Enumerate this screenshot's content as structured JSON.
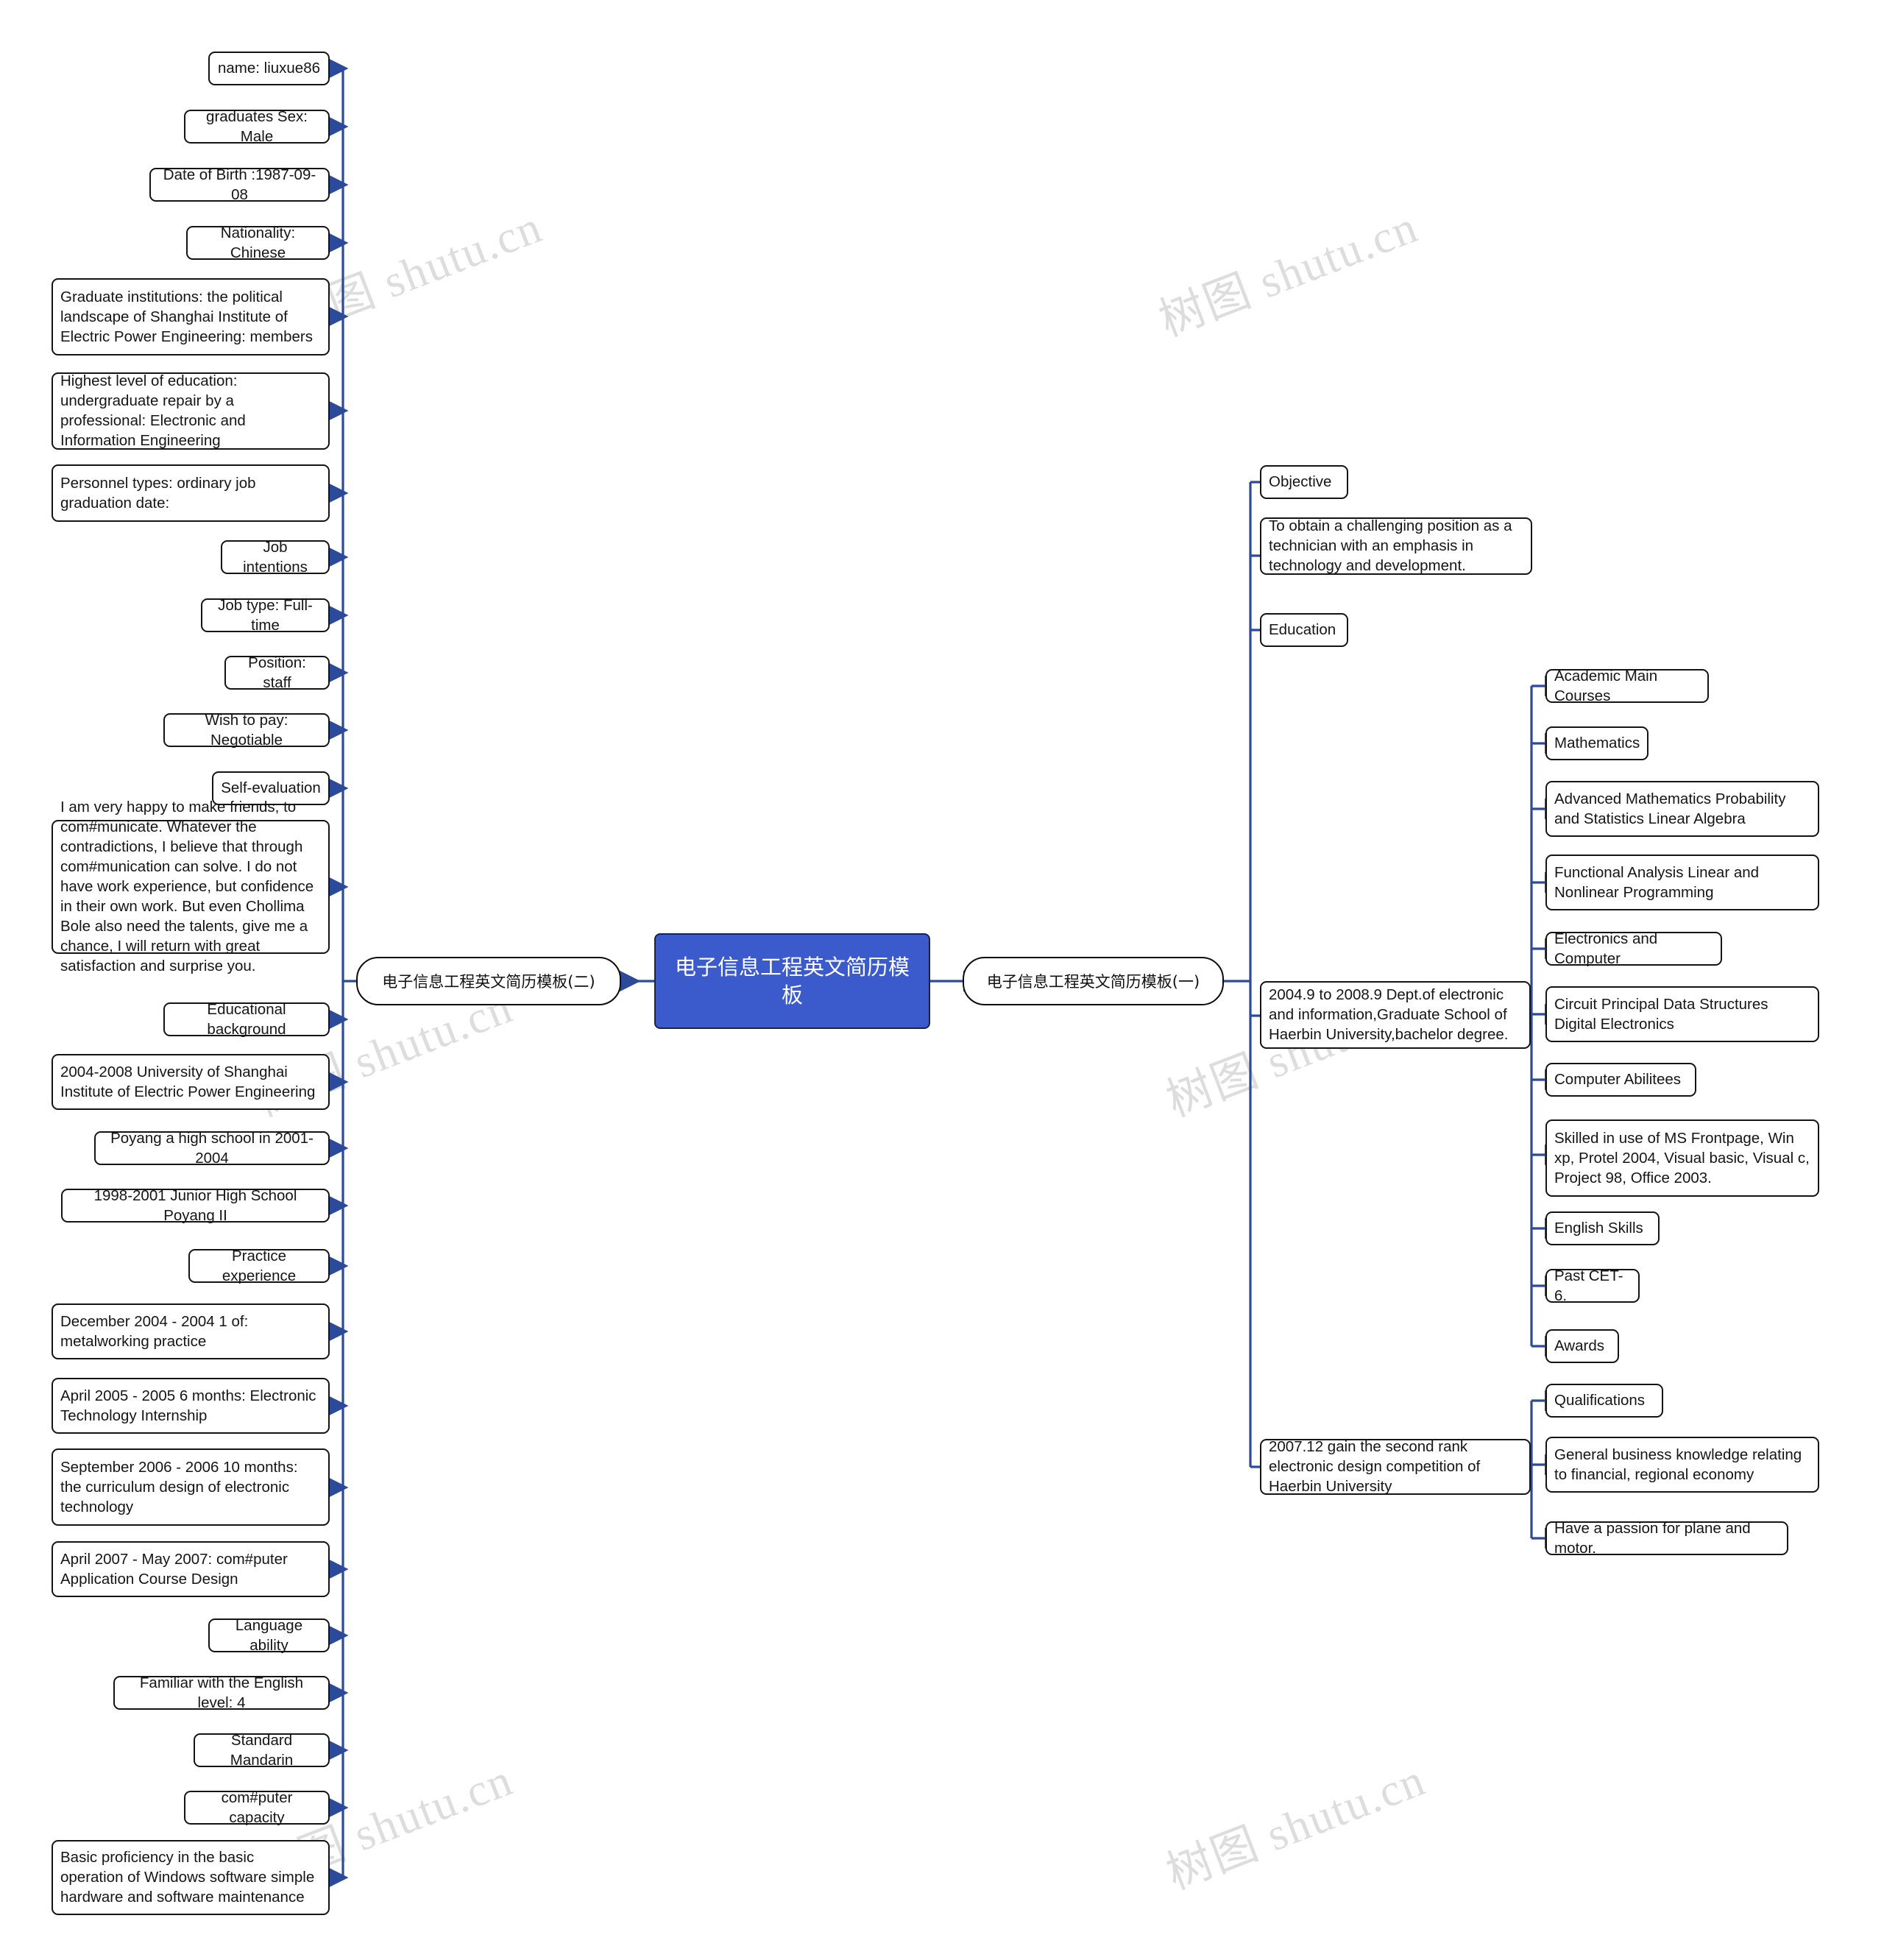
{
  "diagram": {
    "type": "mindmap",
    "root": {
      "label": "电子信息工程英文简历模板"
    },
    "branches": [
      {
        "id": "left-branch",
        "label": "电子信息工程英文简历模板(二)"
      },
      {
        "id": "right-branch",
        "label": "电子信息工程英文简历模板(一)"
      }
    ],
    "left_nodes": [
      {
        "label": "name:  liuxue86"
      },
      {
        "label": "graduates Sex: Male"
      },
      {
        "label": "Date of Birth :1987-09-08"
      },
      {
        "label": "Nationality: Chinese"
      },
      {
        "label": "Graduate institutions: the political landscape of Shanghai Institute of Electric Power Engineering: members"
      },
      {
        "label": "Highest level of education: undergraduate repair by a professional: Electronic and Information Engineering"
      },
      {
        "label": "Personnel types: ordinary job graduation date:"
      },
      {
        "label": "Job intentions"
      },
      {
        "label": "Job type: Full-time"
      },
      {
        "label": "Position: staff"
      },
      {
        "label": "Wish to pay: Negotiable"
      },
      {
        "label": "Self-evaluation"
      },
      {
        "label": "I am very happy to make friends, to com#municate. Whatever the  contradictions, I believe that through com#munication can solve. I do not have  work experience, but confidence in their own work. But even Chollima Bole also  need the talents, give me a chance, I will return with great satisfaction and  surprise you."
      },
      {
        "label": "Educational background"
      },
      {
        "label": "2004-2008 University of Shanghai Institute of Electric Power  Engineering"
      },
      {
        "label": "Poyang a high school in 2001-2004"
      },
      {
        "label": "1998-2001 Junior High School Poyang II"
      },
      {
        "label": "Practice experience"
      },
      {
        "label": "December 2004 - 2004 1 of: metalworking practice"
      },
      {
        "label": "April 2005 - 2005 6 months: Electronic Technology Internship"
      },
      {
        "label": "September 2006 - 2006 10 months: the curriculum design of electronic technology"
      },
      {
        "label": "April 2007 - May 2007: com#puter Application Course Design"
      },
      {
        "label": "Language ability"
      },
      {
        "label": "Familiar with the English level: 4"
      },
      {
        "label": "Standard Mandarin"
      },
      {
        "label": "com#puter capacity"
      },
      {
        "label": "Basic proficiency in the basic operation of  Windows software simple  hardware and software maintenance"
      }
    ],
    "right_level2": [
      {
        "label": "Objective"
      },
      {
        "label": "To obtain a challenging position as a technician with an emphasis in technology and development."
      },
      {
        "label": "Education"
      },
      {
        "label": "2004.9 to 2008.9 Dept.of electronic and information,Graduate School of  Haerbin University,bachelor degree."
      },
      {
        "label": "2007.12 gain the second rank electronic design competition of Haerbin  University"
      }
    ],
    "right_level3_education": [
      {
        "label": "Academic Main Courses"
      },
      {
        "label": "Mathematics"
      },
      {
        "label": "Advanced Mathematics Probability and Statistics Linear Algebra"
      },
      {
        "label": "Functional Analysis Linear and Nonlinear Programming"
      },
      {
        "label": "Electronics and Computer"
      },
      {
        "label": "Circuit Principal Data Structures Digital Electronics"
      },
      {
        "label": "Computer Abilitees"
      },
      {
        "label": "Skilled in use of MS Frontpage, Win xp, Protel 2004, Visual basic, Visual  c, Project  98, Office 2003."
      },
      {
        "label": "English Skills"
      },
      {
        "label": "Past CET-6."
      },
      {
        "label": "Awards"
      }
    ],
    "right_level3_awards": [
      {
        "label": "Qualifications"
      },
      {
        "label": "General business knowledge relating to financial, regional economy"
      },
      {
        "label": "Have a passion for plane and motor."
      }
    ],
    "watermark": {
      "text": "树图 shutu.cn"
    },
    "colors": {
      "root_fill": "#3b5bcc",
      "root_text": "#ffffff",
      "link": "#2c4a9a",
      "node_border": "#141414"
    }
  }
}
